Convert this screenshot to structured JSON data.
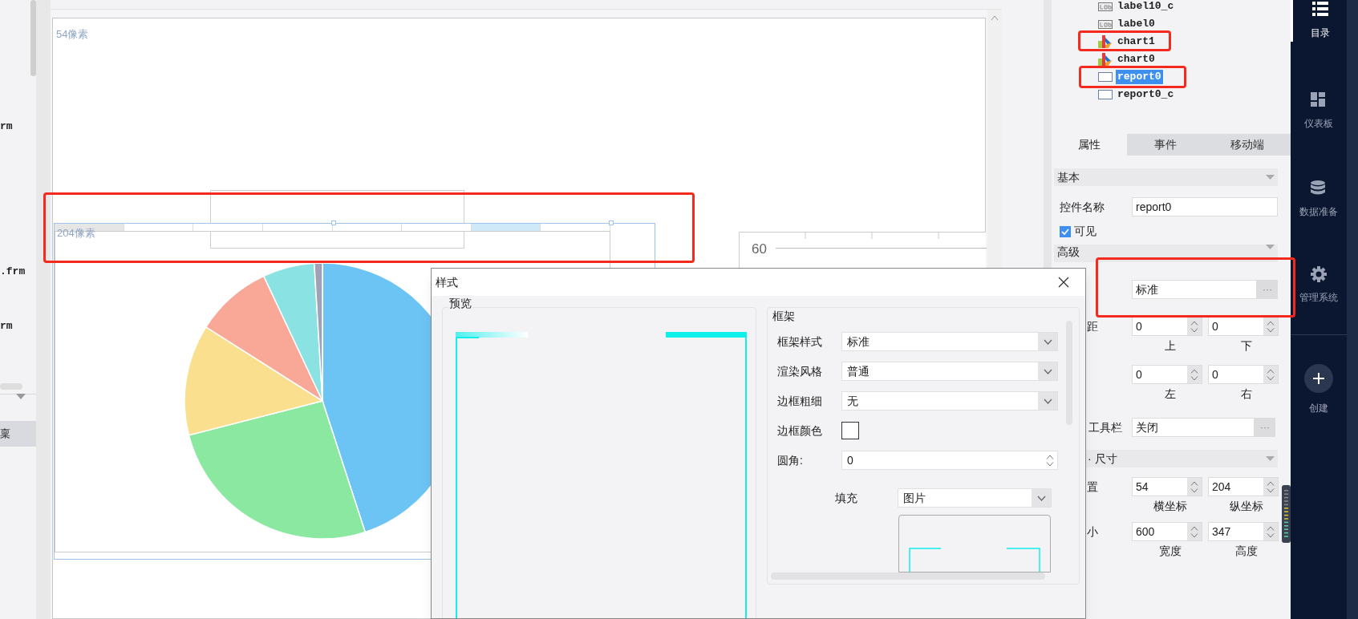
{
  "left_panel": {
    "items": [
      {
        "label": "rm"
      },
      {
        "label": ".frm"
      },
      {
        "label": "rm"
      }
    ],
    "tab": "稟"
  },
  "canvas": {
    "top_marker": "54像素",
    "report_marker": "204像素",
    "axis_label": "60"
  },
  "tree": [
    {
      "label": "label10_c",
      "kind": "label",
      "selected": false
    },
    {
      "label": "label0",
      "kind": "label",
      "selected": false
    },
    {
      "label": "chart1",
      "kind": "chart",
      "selected": false
    },
    {
      "label": "chart0",
      "kind": "chart",
      "selected": false
    },
    {
      "label": "report0",
      "kind": "report",
      "selected": true
    },
    {
      "label": "report0_c",
      "kind": "report",
      "selected": false
    }
  ],
  "properties": {
    "tabs": [
      {
        "label": "属性",
        "selected": true
      },
      {
        "label": "事件",
        "selected": false
      },
      {
        "label": "移动端",
        "selected": false
      }
    ],
    "basic": {
      "title": "基本",
      "name_label": "控件名称",
      "name_value": "report0",
      "visible": {
        "label": "可见",
        "checked": true
      }
    },
    "advanced": {
      "title": "高级",
      "style_value": "标准",
      "style_more": "···",
      "margin_label": "距",
      "margins": [
        {
          "value": "0",
          "label": "上"
        },
        {
          "value": "0",
          "label": "下"
        },
        {
          "value": "0",
          "label": "左"
        },
        {
          "value": "0",
          "label": "右"
        }
      ],
      "toolbar_label": "工具栏",
      "toolbar_value": "关闭",
      "toolbar_more": "···"
    },
    "size": {
      "title": "· 尺寸",
      "position_label": "置",
      "position": [
        {
          "value": "54",
          "label": "横坐标"
        },
        {
          "value": "204",
          "label": "纵坐标"
        }
      ],
      "size_label": "小",
      "size": [
        {
          "value": "600",
          "label": "宽度"
        },
        {
          "value": "347",
          "label": "高度"
        }
      ]
    }
  },
  "nav": [
    {
      "label": "目录",
      "kind": "list",
      "selected": true
    },
    {
      "label": "仪表板",
      "kind": "dashboard",
      "selected": false
    },
    {
      "label": "数据准备",
      "kind": "database",
      "selected": false
    },
    {
      "label": "管理系统",
      "kind": "settings",
      "selected": false
    },
    {
      "label": "创建",
      "kind": "create",
      "selected": false
    }
  ],
  "dialog": {
    "title": "样式",
    "preview_title": "预览",
    "frame_title": "框架",
    "fields": [
      {
        "label": "框架样式",
        "kind": "select",
        "value": "标准"
      },
      {
        "label": "渲染风格",
        "kind": "select",
        "value": "普通"
      },
      {
        "label": "边框粗细",
        "kind": "select",
        "value": "无"
      },
      {
        "label": "边框颜色",
        "kind": "color"
      },
      {
        "label": "圆角:",
        "kind": "number",
        "value": "0"
      }
    ],
    "fill": {
      "label": "填充",
      "value": "图片"
    }
  }
}
